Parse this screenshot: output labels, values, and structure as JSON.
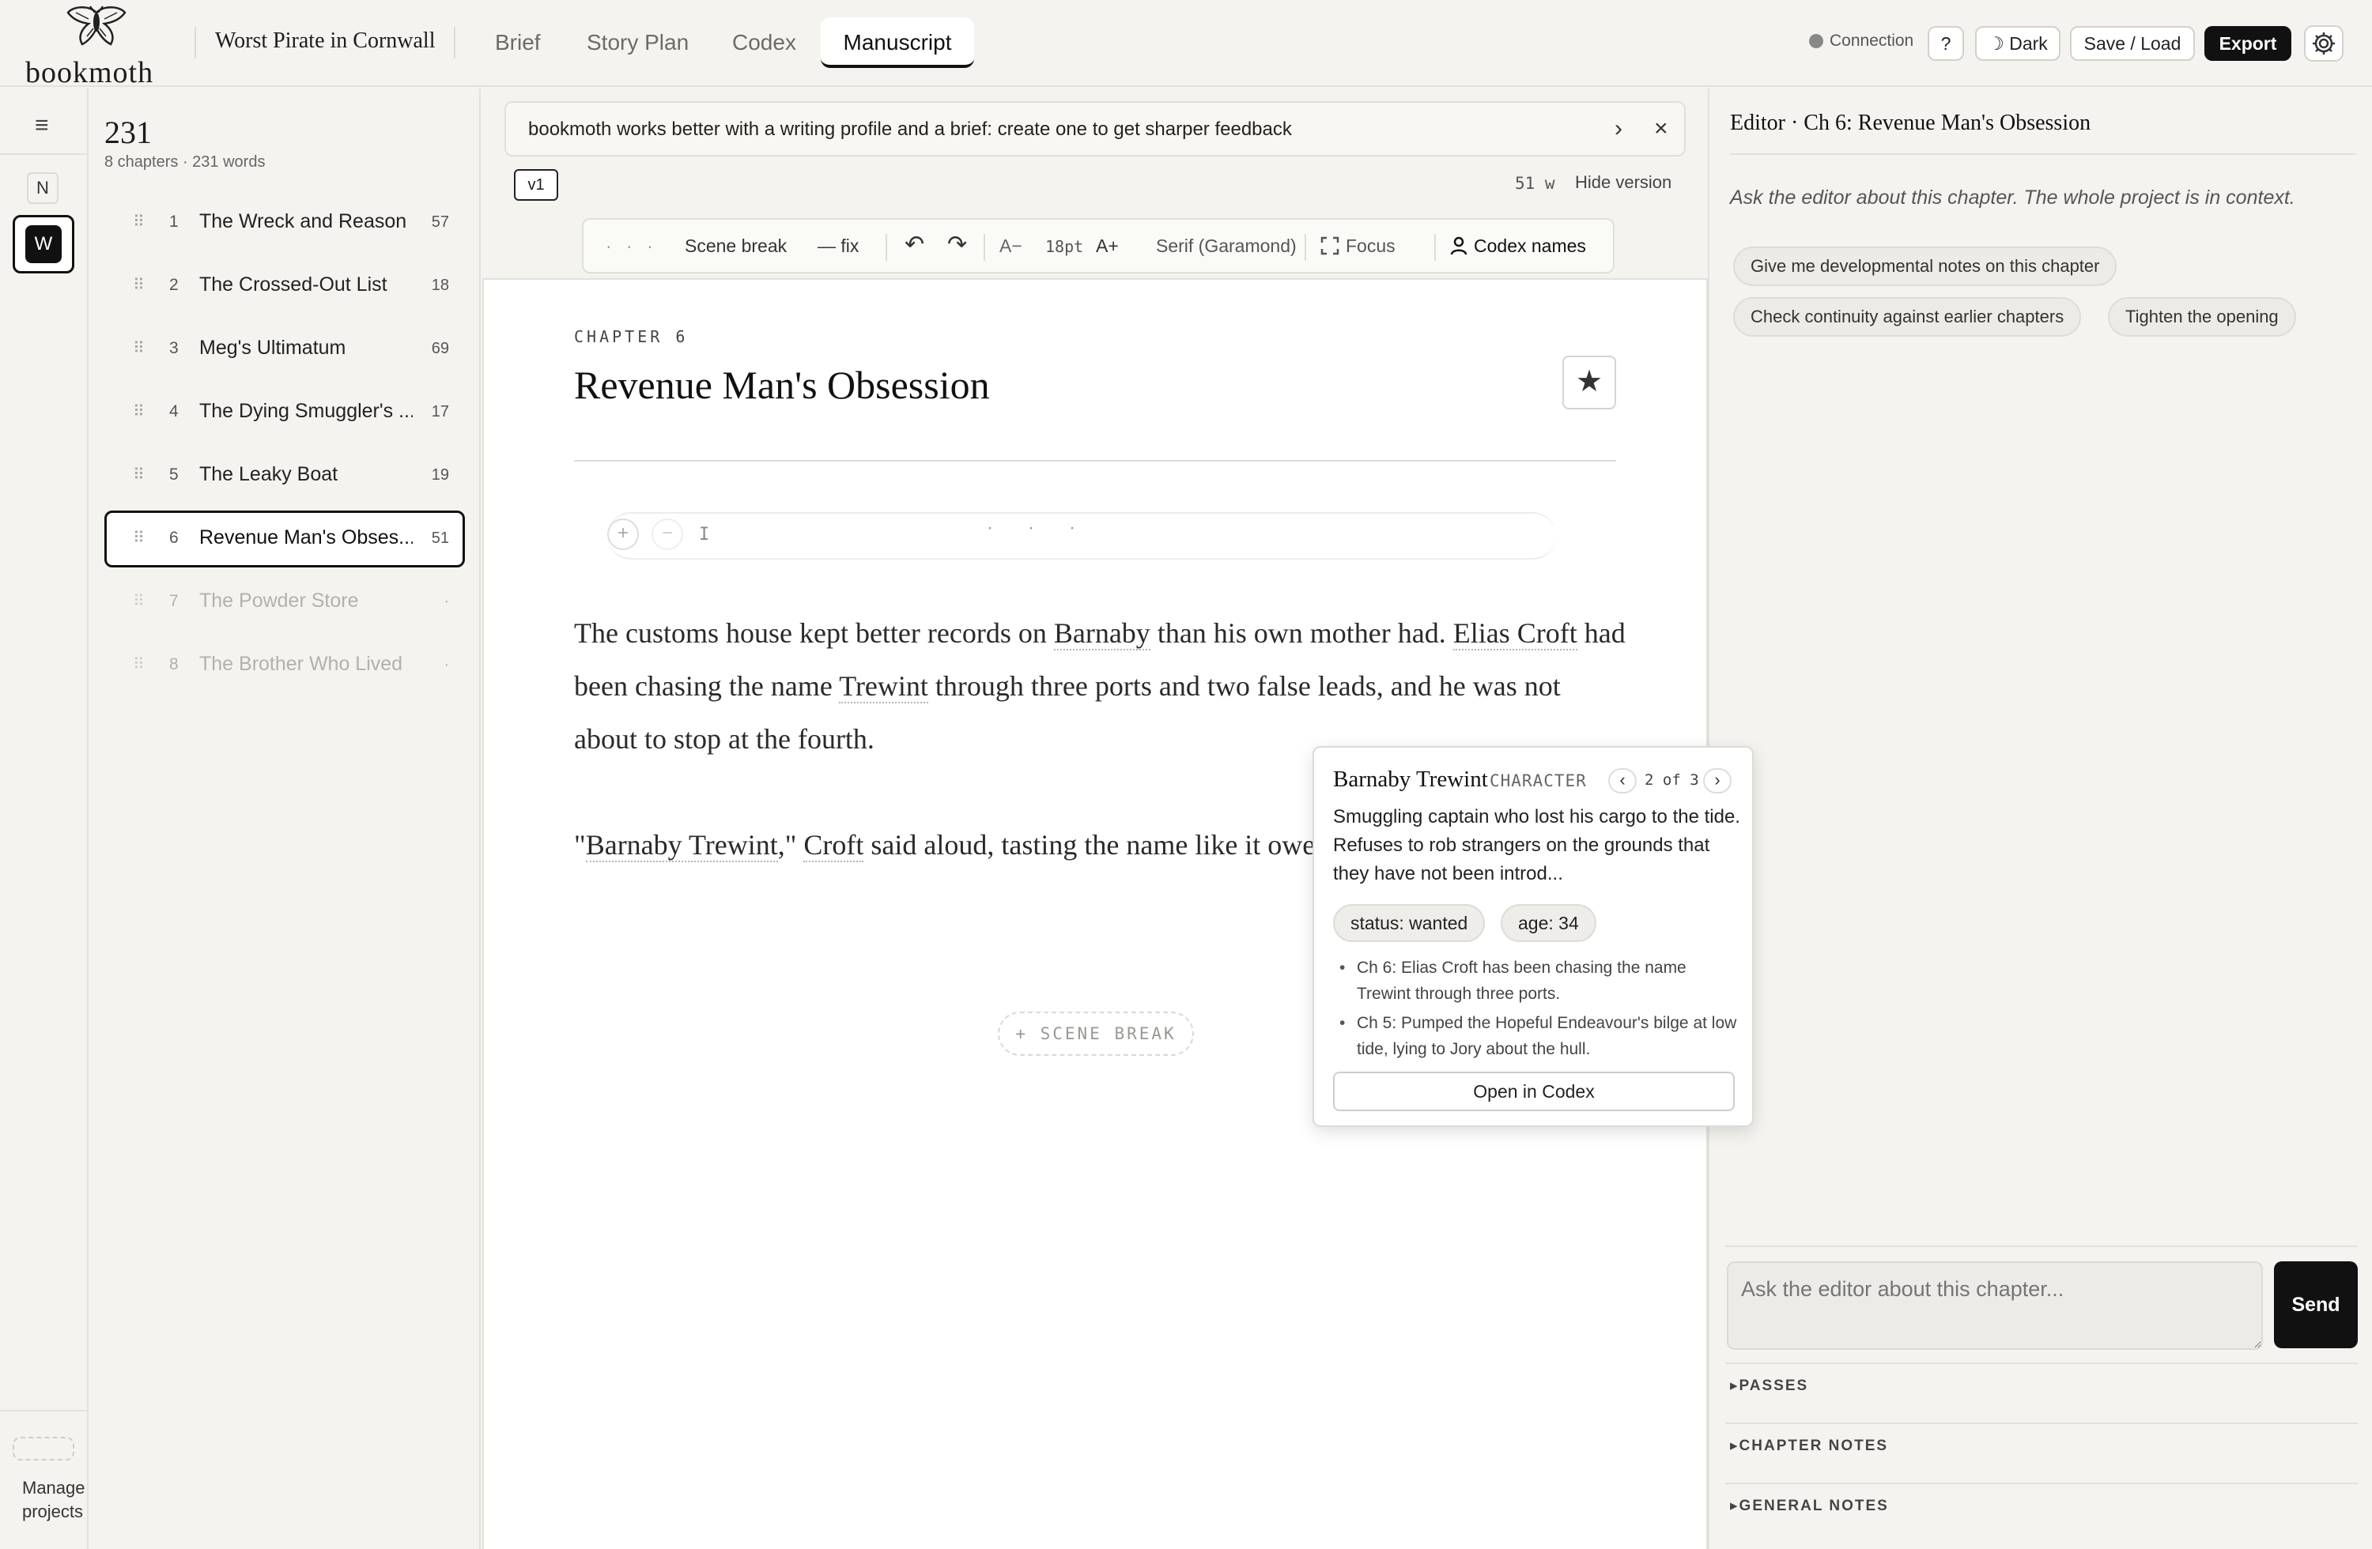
{
  "app": {
    "brand": "bookmoth",
    "project_title": "Worst Pirate in Cornwall"
  },
  "nav": {
    "tabs": [
      {
        "label": "Brief"
      },
      {
        "label": "Story Plan"
      },
      {
        "label": "Codex"
      },
      {
        "label": "Manuscript",
        "active": true
      }
    ]
  },
  "header_actions": {
    "connection": "Connection",
    "help": "?",
    "theme": "☽ Dark",
    "save_load": "Save / Load",
    "export": "Export"
  },
  "rail": {
    "menu_icon": "≡",
    "profile_n": "N",
    "profile_w": "W",
    "manage_line1": "Manage",
    "manage_line2": "projects"
  },
  "chapter_list": {
    "total_words": "231",
    "summary": "8 chapters · 231 words",
    "chapters": [
      {
        "num": "1",
        "title": "The Wreck and Reason",
        "words": "57"
      },
      {
        "num": "2",
        "title": "The Crossed-Out List",
        "words": "18"
      },
      {
        "num": "3",
        "title": "Meg's Ultimatum",
        "words": "69"
      },
      {
        "num": "4",
        "title": "The Dying Smuggler's ...",
        "words": "17"
      },
      {
        "num": "5",
        "title": "The Leaky Boat",
        "words": "19"
      },
      {
        "num": "6",
        "title": "Revenue Man's Obses...",
        "words": "51",
        "active": true
      },
      {
        "num": "7",
        "title": "The Powder Store",
        "words": "·",
        "dim": true
      },
      {
        "num": "8",
        "title": "The Brother Who Lived",
        "words": "·",
        "dim": true
      }
    ]
  },
  "banner": {
    "text": "bookmoth works better with a writing profile and a brief: create one to get sharper feedback",
    "arrow": "›",
    "close": "×"
  },
  "version": {
    "badge": "v1",
    "words": "51 w",
    "hide_label": "Hide version"
  },
  "toolbar": {
    "dots": "· · ·",
    "scene_break": "Scene break",
    "fix": "— fix",
    "undo_icon": "↶",
    "redo_icon": "↷",
    "font_smaller": "A−",
    "font_size": "18pt",
    "font_larger": "A+",
    "font_family": "Serif (Garamond)",
    "focus": "Focus",
    "codex_names": "Codex names"
  },
  "editor": {
    "chapter_label": "CHAPTER 6",
    "chapter_title": "Revenue Man's Obsession",
    "star_icon": "★",
    "para_plus": "+",
    "para_minus": "−",
    "para_cursor": "I",
    "para_dots": "···",
    "p1": {
      "a": "The customs house kept better records on ",
      "n1": "Barnaby",
      "b": " than his own mother had. ",
      "n2": "Elias Croft",
      "c": " had been chasing the name ",
      "n3": "Trewint",
      "d": " through three ports and two false leads, and he was not about to stop at the fourth."
    },
    "p2": {
      "a": "\"",
      "n1": "Barnaby Trewint",
      "b": ",\" ",
      "n2": "Croft",
      "c": " said aloud, tasting the name like it owed him"
    },
    "scene_break_btn": "+ SCENE BREAK"
  },
  "codex_popover": {
    "name": "Barnaby Trewint",
    "type": "CHARACTER",
    "prev": "‹",
    "next": "›",
    "pager": "2 of 3",
    "description": "Smuggling captain who lost his cargo to the tide. Refuses to rob strangers on the grounds that they have not been introd...",
    "chips": [
      "status: wanted",
      "age: 34"
    ],
    "mentions": [
      "Ch 6: Elias Croft has been chasing the name Trewint through three ports.",
      "Ch 5: Pumped the Hopeful Endeavour's bilge at low tide, lying to Jory about the hull."
    ],
    "open_button": "Open in Codex"
  },
  "editor_panel": {
    "heading": "Editor · Ch 6: Revenue Man's Obsession",
    "hint": "Ask the editor about this chapter. The whole project is in context.",
    "prompts": [
      "Give me developmental notes on this chapter",
      "Check continuity against earlier chapters",
      "Tighten the opening"
    ],
    "input_placeholder": "Ask the editor about this chapter...",
    "send": "Send",
    "sections": [
      "▸PASSES",
      "▸CHAPTER NOTES",
      "▸GENERAL NOTES"
    ]
  },
  "colors": {
    "background": "#f4f3ef",
    "accent": "#111111",
    "page": "#ffffff",
    "chip": "#eeede9"
  }
}
